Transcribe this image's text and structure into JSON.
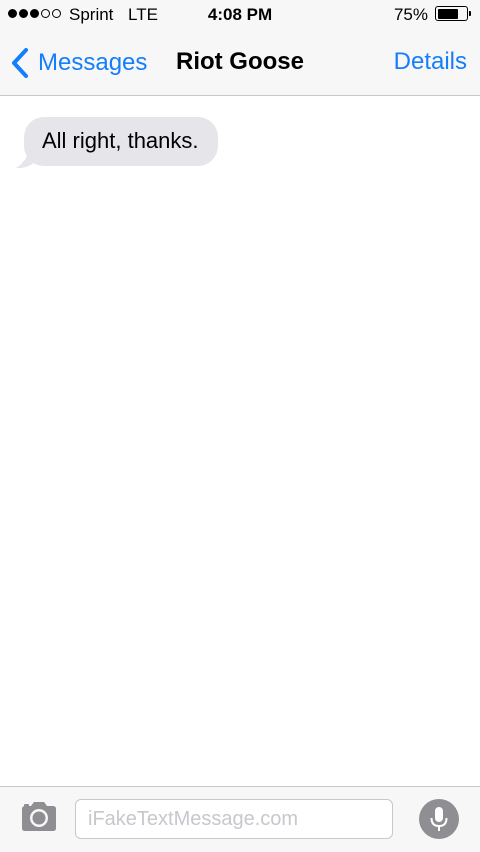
{
  "status_bar": {
    "signal": {
      "filled": 3,
      "total": 5
    },
    "carrier": "Sprint",
    "network": "LTE",
    "time": "4:08 PM",
    "battery_text": "75%",
    "battery_level": 0.75
  },
  "nav": {
    "back_label": "Messages",
    "back_icon": "chevron-left-icon",
    "title": "Riot Goose",
    "details_label": "Details"
  },
  "messages": [
    {
      "direction": "incoming",
      "text": "All right, thanks."
    }
  ],
  "input_bar": {
    "camera_icon": "camera-icon",
    "placeholder": "iFakeTextMessage.com",
    "value": "",
    "mic_icon": "microphone-icon"
  },
  "colors": {
    "accent": "#147efb",
    "incoming_bubble": "#e5e5ea",
    "bar_background": "#f7f7f7",
    "separator": "#c8c7cc",
    "icon_gray": "#8e8e93"
  }
}
